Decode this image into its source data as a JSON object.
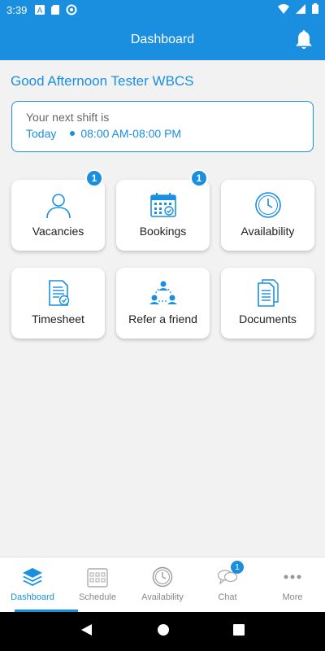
{
  "status": {
    "time": "3:39"
  },
  "appbar": {
    "title": "Dashboard",
    "notify_icon": "bell-icon"
  },
  "greeting": "Good Afternoon Tester WBCS",
  "shift": {
    "label": "Your next shift is",
    "day": "Today",
    "time": "08:00 AM-08:00 PM"
  },
  "tiles": [
    {
      "label": "Vacancies",
      "icon": "user-icon",
      "badge": "1"
    },
    {
      "label": "Bookings",
      "icon": "calendar-icon",
      "badge": "1"
    },
    {
      "label": "Availability",
      "icon": "clock-icon"
    },
    {
      "label": "Timesheet",
      "icon": "timesheet-icon"
    },
    {
      "label": "Refer a friend",
      "icon": "refer-icon"
    },
    {
      "label": "Documents",
      "icon": "documents-icon"
    }
  ],
  "tabs": [
    {
      "label": "Dashboard",
      "icon": "layers-icon",
      "active": true
    },
    {
      "label": "Schedule",
      "icon": "schedule-icon"
    },
    {
      "label": "Availability",
      "icon": "clock-icon"
    },
    {
      "label": "Chat",
      "icon": "chat-icon",
      "badge": "1"
    },
    {
      "label": "More",
      "icon": "more-icon"
    }
  ],
  "colors": {
    "primary": "#1a8fe0",
    "background": "#f2f2f2"
  }
}
